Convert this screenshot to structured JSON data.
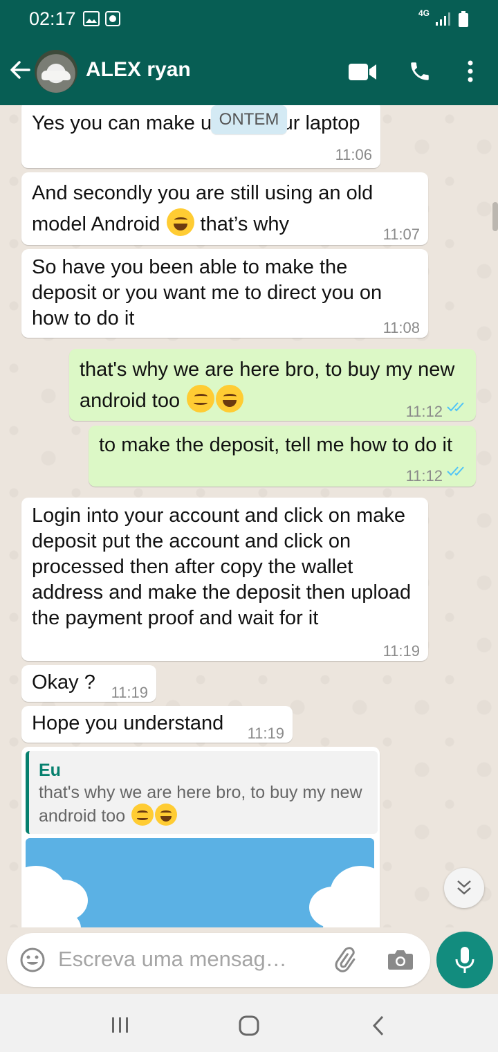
{
  "status_bar": {
    "time": "02:17",
    "network": "4G"
  },
  "header": {
    "contact_name": "ALEX ryan"
  },
  "day_chip": "ONTEM",
  "messages": [
    {
      "dir": "in",
      "text": "Yes you can make use of your laptop",
      "time": "11:06"
    },
    {
      "dir": "in",
      "text_line1": "And secondly you are still using an old",
      "text_line2_a": "model Android",
      "emoji": "face-with-tears-of-joy",
      "text_line2_b": "that’s why",
      "time": "11:07"
    },
    {
      "dir": "in",
      "text": "So have you been able to make the deposit or you want me to direct you on how to do it",
      "time": "11:08"
    },
    {
      "dir": "out",
      "text_line1": "that's why we are here bro, to buy my new",
      "text_line2": "android too",
      "emojis": [
        "smirking-face",
        "grinning-face-with-sweat"
      ],
      "time": "11:12",
      "status": "read"
    },
    {
      "dir": "out",
      "text": "to make the deposit, tell me how to do it",
      "time": "11:12",
      "status": "read"
    },
    {
      "dir": "in",
      "text": "Login into your account and click on make deposit put the account and click on processed then after copy the wallet address and make the deposit then upload the payment proof and wait for it",
      "time": "11:19"
    },
    {
      "dir": "in",
      "text": "Okay ?",
      "time": "11:19"
    },
    {
      "dir": "in",
      "text": "Hope you understand",
      "time": "11:19"
    },
    {
      "dir": "in",
      "reply_author": "Eu",
      "reply_text": "that's why we are here bro, to buy my new android too",
      "has_image": true
    }
  ],
  "composer": {
    "placeholder": "Escreva uma mensag…"
  }
}
